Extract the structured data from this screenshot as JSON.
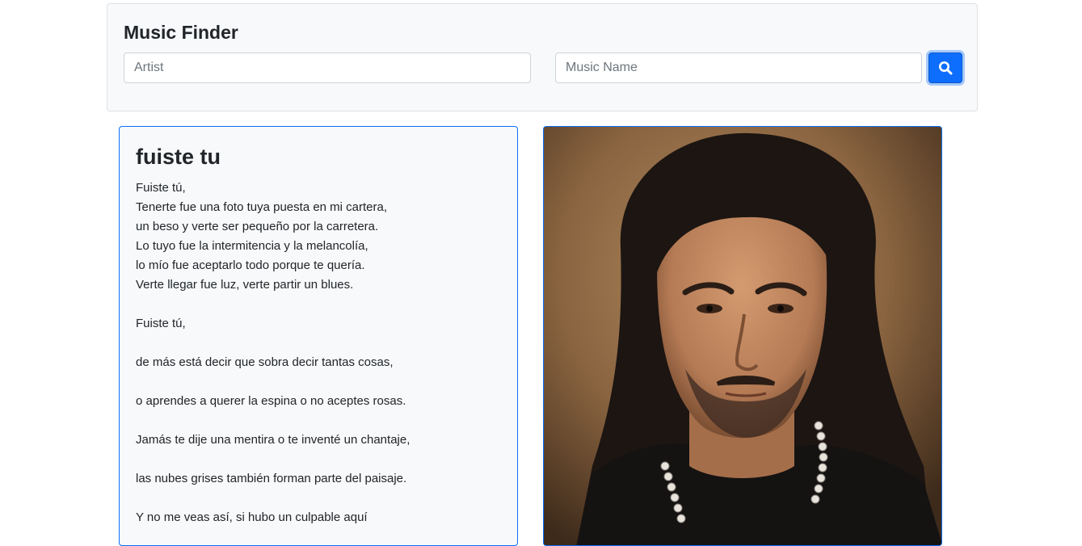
{
  "app": {
    "title": "Music Finder"
  },
  "search": {
    "artist_placeholder": "Artist",
    "artist_value": "",
    "music_placeholder": "Music Name",
    "music_value": "",
    "button_icon": "search-icon"
  },
  "song": {
    "title": "fuiste tu",
    "lyrics": [
      "Fuiste tú,",
      "Tenerte fue una foto tuya puesta en mi cartera,",
      "un beso y verte ser pequeño por la carretera.",
      "Lo tuyo fue la intermitencia y la melancolía,",
      "lo mío fue aceptarlo todo porque te quería.",
      "Verte llegar fue luz, verte partir un blues.",
      "",
      "Fuiste tú,",
      "",
      "de más está decir que sobra decir tantas cosas,",
      "",
      "o aprendes a querer la espina o no aceptes rosas.",
      "",
      "Jamás te dije una mentira o te inventé un chantaje,",
      "",
      "las nubes grises también forman parte del paisaje.",
      "",
      "Y no me veas así, si hubo un culpable aquí"
    ]
  },
  "artist_photo": {
    "icon": "artist-photo",
    "colors": {
      "background": "#8a6440",
      "hair": "#1c1512",
      "skin": "#c28a62",
      "shirt": "#151212",
      "beads": "#e8e4dc"
    }
  },
  "colors": {
    "accent": "#0d6efd",
    "header_bg": "#f8f9fa"
  }
}
